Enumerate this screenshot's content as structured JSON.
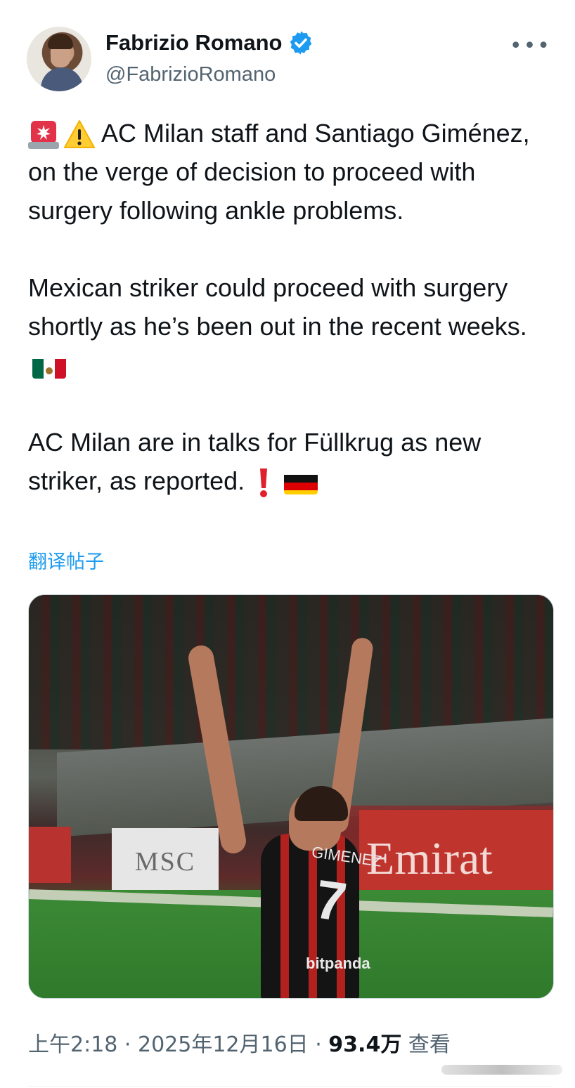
{
  "author": {
    "display_name": "Fabrizio Romano",
    "handle": "@FabrizioRomano",
    "verified_color": "#1d9bf0"
  },
  "menu": {
    "more_label": "•••"
  },
  "tweet": {
    "para1": "AC Milan staff and Santiago Giménez, on the verge of decision to proceed with surgery following ankle problems.",
    "para2": "Mexican striker could proceed with surgery shortly as he’s been out in the recent weeks.",
    "para3": "AC Milan are in talks for Füllkrug as new striker, as reported.",
    "emojis": [
      "siren-icon",
      "warning-icon",
      "mexico-flag-icon",
      "red-exclamation-icon",
      "germany-flag-icon"
    ]
  },
  "translate_label": "翻译帖子",
  "media": {
    "jersey_name": "GIMENEZ",
    "jersey_number": "7",
    "sponsor": "bitpanda",
    "board_msc": "MSC",
    "board_emirates": "Emirat"
  },
  "meta": {
    "time": "上午2:18",
    "sep1": " · ",
    "date": "2025年12月16日",
    "sep2": " · ",
    "views": "93.4万",
    "views_label": " 查看"
  },
  "colors": {
    "link": "#1d9bf0",
    "muted": "#536471",
    "text": "#0f1419"
  }
}
